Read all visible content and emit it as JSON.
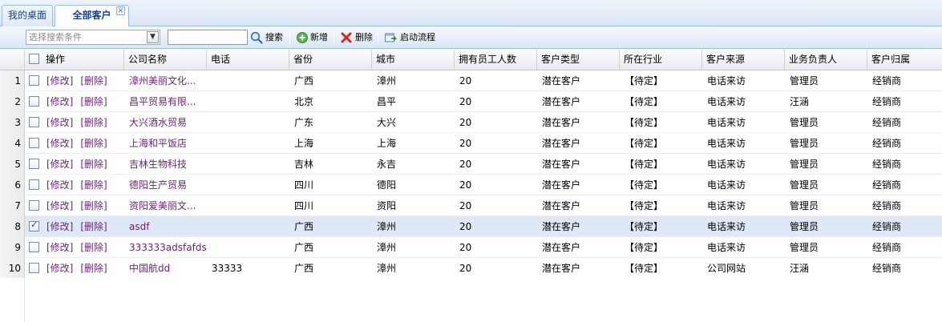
{
  "tabs": [
    {
      "label": "我的桌面",
      "active": false
    },
    {
      "label": "全部客户",
      "active": true,
      "closable": true,
      "close_glyph": "×"
    }
  ],
  "toolbar": {
    "select_placeholder": "选择搜索条件",
    "search_value": "",
    "search_label": "搜索",
    "add_label": "新增",
    "delete_label": "删除",
    "workflow_label": "启动流程"
  },
  "columns": [
    "操作",
    "公司名称",
    "电话",
    "省份",
    "城市",
    "拥有员工人数",
    "客户类型",
    "所在行业",
    "客户来源",
    "业务负责人",
    "客户归属"
  ],
  "actions": {
    "edit": "[修改]",
    "delete": "[删除]"
  },
  "rows": [
    {
      "num": "1",
      "checked": false,
      "company": "漳州美丽文化...",
      "phone": "",
      "province": "广西",
      "city": "漳州",
      "employees": "20",
      "type": "潜在客户",
      "industry": "【待定】",
      "source": "电话来访",
      "owner": "管理员",
      "belong": "经销商"
    },
    {
      "num": "2",
      "checked": false,
      "company": "昌平贸易有限...",
      "phone": "",
      "province": "北京",
      "city": "昌平",
      "employees": "20",
      "type": "潜在客户",
      "industry": "【待定】",
      "source": "电话来访",
      "owner": "汪涵",
      "belong": "经销商"
    },
    {
      "num": "3",
      "checked": false,
      "company": "大兴酒水贸易",
      "phone": "",
      "province": "广东",
      "city": "大兴",
      "employees": "20",
      "type": "潜在客户",
      "industry": "【待定】",
      "source": "电话来访",
      "owner": "管理员",
      "belong": "经销商"
    },
    {
      "num": "4",
      "checked": false,
      "company": "上海和平饭店",
      "phone": "",
      "province": "上海",
      "city": "上海",
      "employees": "20",
      "type": "潜在客户",
      "industry": "【待定】",
      "source": "电话来访",
      "owner": "管理员",
      "belong": "经销商"
    },
    {
      "num": "5",
      "checked": false,
      "company": "吉林生物科技",
      "phone": "",
      "province": "吉林",
      "city": "永吉",
      "employees": "20",
      "type": "潜在客户",
      "industry": "【待定】",
      "source": "电话来访",
      "owner": "管理员",
      "belong": "经销商"
    },
    {
      "num": "6",
      "checked": false,
      "company": "德阳生产贸易",
      "phone": "",
      "province": "四川",
      "city": "德阳",
      "employees": "20",
      "type": "潜在客户",
      "industry": "【待定】",
      "source": "电话来访",
      "owner": "管理员",
      "belong": "经销商"
    },
    {
      "num": "7",
      "checked": false,
      "company": "资阳爱美丽文...",
      "phone": "",
      "province": "四川",
      "city": "资阳",
      "employees": "20",
      "type": "潜在客户",
      "industry": "【待定】",
      "source": "电话来访",
      "owner": "管理员",
      "belong": "经销商"
    },
    {
      "num": "8",
      "checked": true,
      "company": "asdf",
      "phone": "",
      "province": "广西",
      "city": "漳州",
      "employees": "20",
      "type": "潜在客户",
      "industry": "【待定】",
      "source": "电话来访",
      "owner": "管理员",
      "belong": "经销商"
    },
    {
      "num": "9",
      "checked": false,
      "company": "333333adsfafds",
      "phone": "",
      "province": "广西",
      "city": "漳州",
      "employees": "20",
      "type": "潜在客户",
      "industry": "【待定】",
      "source": "电话来访",
      "owner": "管理员",
      "belong": "经销商"
    },
    {
      "num": "10",
      "checked": false,
      "company": "中国航dd",
      "phone": "33333",
      "province": "广西",
      "city": "漳州",
      "employees": "20",
      "type": "潜在客户",
      "industry": "【待定】",
      "source": "公司网站",
      "owner": "汪涵",
      "belong": "经销商"
    }
  ],
  "colors": {
    "link": "#6b1f7a",
    "selected_row": "#dfe8f6",
    "tab_border": "#99bbe8",
    "tab_text": "#15428b"
  },
  "icons": [
    "search-icon",
    "add-icon",
    "delete-icon",
    "workflow-icon",
    "dropdown-arrow-icon",
    "close-icon"
  ]
}
